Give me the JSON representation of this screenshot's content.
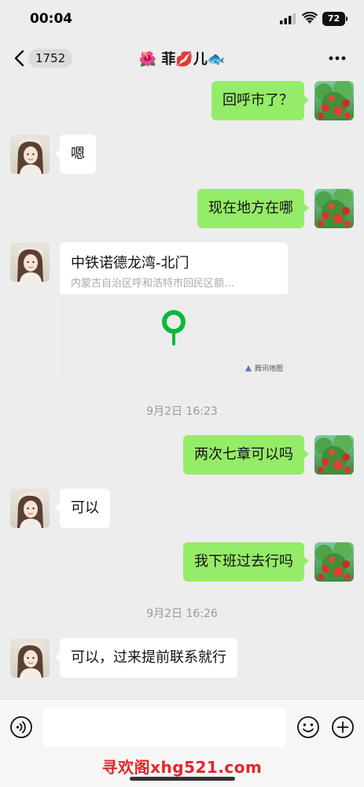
{
  "status_bar": {
    "time": "00:04",
    "battery": "72"
  },
  "nav": {
    "unread_count": "1752",
    "title": "🌺 菲💋儿🐟"
  },
  "messages": [
    {
      "sender": "me",
      "text": "回呼市了？"
    },
    {
      "sender": "contact",
      "text": "嗯"
    },
    {
      "sender": "me",
      "text": "现在地方在哪"
    },
    {
      "sender": "contact",
      "type": "location",
      "title": "中铁诺德龙湾-北门",
      "address": "内蒙古自治区呼和浩特市回民区额…",
      "map_provider": "腾讯地图"
    },
    {
      "type": "timestamp",
      "text": "9月2日 16:23"
    },
    {
      "sender": "me",
      "text": "两次七章可以吗"
    },
    {
      "sender": "contact",
      "text": "可以"
    },
    {
      "sender": "me",
      "text": "我下班过去行吗"
    },
    {
      "type": "timestamp",
      "text": "9月2日 16:26"
    },
    {
      "sender": "contact",
      "text": "可以，过来提前联系就行"
    }
  ],
  "input": {
    "value": "",
    "placeholder": ""
  },
  "watermark": "寻欢阁xhg521.com",
  "colors": {
    "outgoing_bubble": "#95ec69",
    "incoming_bubble": "#ffffff",
    "background": "#ededed",
    "map_pin": "#09b83e",
    "watermark": "#e2252b"
  },
  "icons": {
    "back": "chevron-left-icon",
    "more": "ellipsis-icon",
    "voice": "voice-icon",
    "emoji": "emoji-icon",
    "plus": "plus-icon",
    "pin": "map-pin-icon"
  }
}
